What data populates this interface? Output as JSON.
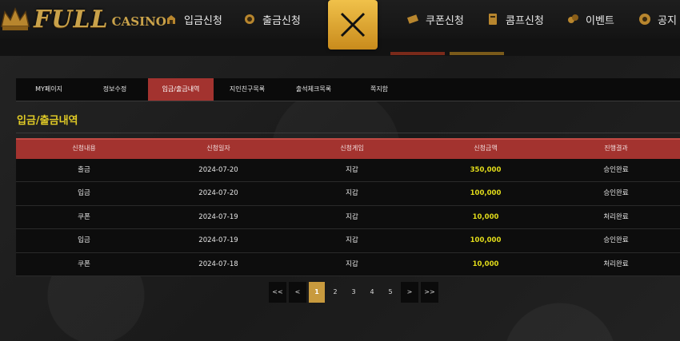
{
  "brand": {
    "name": "FULL",
    "sub": "CASINO"
  },
  "nav": [
    {
      "label": "입금신청",
      "icon": "deposit-icon"
    },
    {
      "label": "출금신청",
      "icon": "withdraw-icon"
    },
    {
      "label": "쿠폰신청",
      "icon": "coupon-icon"
    },
    {
      "label": "콤프신청",
      "icon": "comp-icon"
    },
    {
      "label": "이벤트",
      "icon": "event-icon"
    },
    {
      "label": "공지",
      "icon": "notice-icon"
    }
  ],
  "tabs": [
    {
      "label": "MY페이지",
      "active": false
    },
    {
      "label": "정보수정",
      "active": false
    },
    {
      "label": "입금/출금내역",
      "active": true
    },
    {
      "label": "지인친구목록",
      "active": false
    },
    {
      "label": "출석체크목록",
      "active": false
    },
    {
      "label": "쪽지함",
      "active": false
    }
  ],
  "page_title": "입금/출금내역",
  "table": {
    "headers": [
      "신청내용",
      "신청일자",
      "신청게임",
      "신청금액",
      "진행결과"
    ],
    "rows": [
      {
        "type": "출금",
        "date": "2024-07-20",
        "game": "지갑",
        "amount": "350,000",
        "status": "승인완료"
      },
      {
        "type": "입금",
        "date": "2024-07-20",
        "game": "지갑",
        "amount": "100,000",
        "status": "승인완료"
      },
      {
        "type": "쿠폰",
        "date": "2024-07-19",
        "game": "지갑",
        "amount": "10,000",
        "status": "처리완료"
      },
      {
        "type": "입금",
        "date": "2024-07-19",
        "game": "지갑",
        "amount": "100,000",
        "status": "승인완료"
      },
      {
        "type": "쿠폰",
        "date": "2024-07-18",
        "game": "지갑",
        "amount": "10,000",
        "status": "처리완료"
      }
    ]
  },
  "pagination": {
    "first": "<<",
    "prev": "<",
    "pages": [
      "1",
      "2",
      "3",
      "4",
      "5"
    ],
    "current": "1",
    "next": ">",
    "last": ">>"
  },
  "colors": {
    "accent": "#a3332f",
    "gold": "#c89a3e",
    "highlight": "#e2dc1a"
  }
}
